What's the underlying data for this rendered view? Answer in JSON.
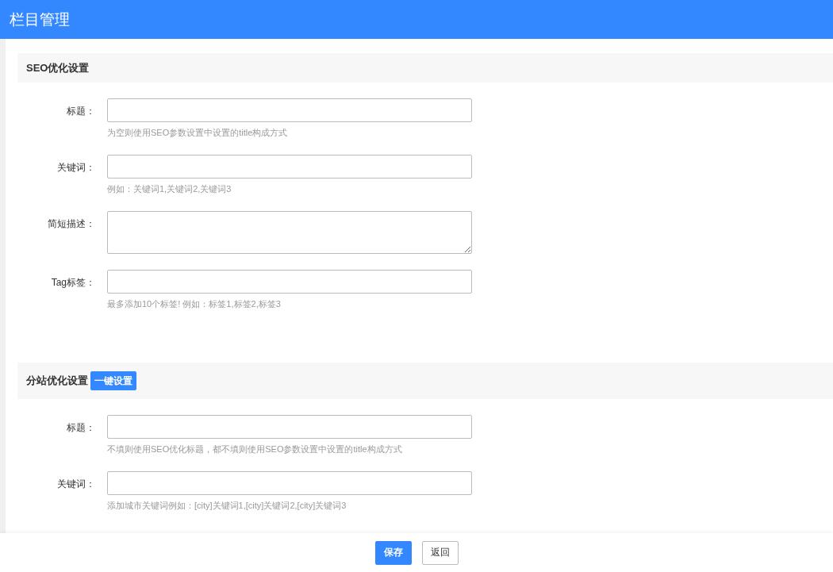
{
  "header": {
    "title": "栏目管理"
  },
  "sections": [
    {
      "title": "SEO优化设置",
      "fields": [
        {
          "label": "标题：",
          "kind": "input",
          "hint": "为空则使用SEO参数设置中设置的title构成方式"
        },
        {
          "label": "关键词：",
          "kind": "input",
          "hint": "例如：关键词1,关键词2,关键词3"
        },
        {
          "label": "简短描述：",
          "kind": "textarea"
        },
        {
          "label": "Tag标签：",
          "kind": "input",
          "hint": "最多添加10个标签! 例如：标签1,标签2,标签3"
        }
      ]
    },
    {
      "title": "分站优化设置",
      "action": "一键设置",
      "fields": [
        {
          "label": "标题：",
          "kind": "input",
          "hint": "不填则使用SEO优化标题，都不填则使用SEO参数设置中设置的title构成方式"
        },
        {
          "label": "关键词：",
          "kind": "input",
          "hint": "添加城市关键词例如：[city]关键词1,[city]关键词2,[city]关键词3"
        }
      ]
    }
  ],
  "footer": {
    "buttons": [
      {
        "label": "保存",
        "kind": "primary"
      },
      {
        "label": "返回",
        "kind": "default"
      }
    ]
  }
}
